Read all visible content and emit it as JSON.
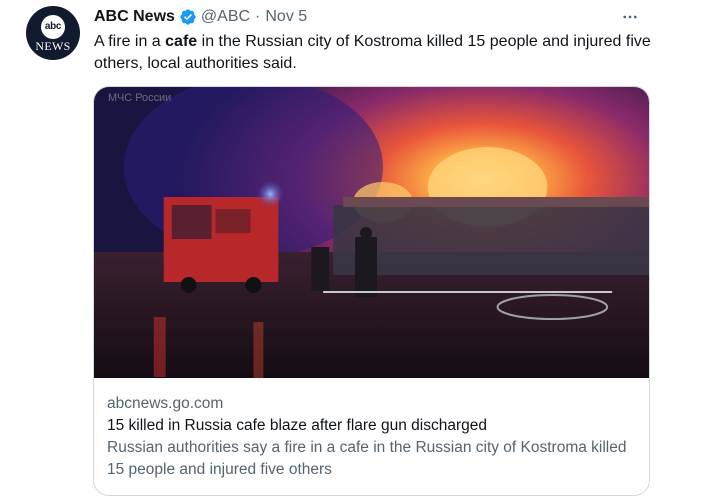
{
  "tweet": {
    "avatar": {
      "logo_text": "abc",
      "word": "NEWS"
    },
    "display_name": "ABC News",
    "handle": "@ABC",
    "separator": "·",
    "date": "Nov 5",
    "text_before": "A fire in a ",
    "text_bold": "cafe",
    "text_after": " in the Russian city of Kostroma killed 15 people and injured five others, local authorities said."
  },
  "card": {
    "image_alt": "Firefighters and fire trucks at night in front of a burning cafe",
    "watermark": "МЧС России",
    "domain": "abcnews.go.com",
    "title": "15 killed in Russia cafe blaze after flare gun discharged",
    "description": "Russian authorities say a fire in a cafe in the Russian city of Kostroma killed 15 people and injured five others"
  },
  "colors": {
    "verified": "#1d9bf0",
    "secondary_text": "#536471",
    "border": "#cfd9de",
    "avatar_bg": "#121a2e"
  },
  "icons": {
    "verified": "verified-badge-icon",
    "more": "more-options-icon"
  }
}
